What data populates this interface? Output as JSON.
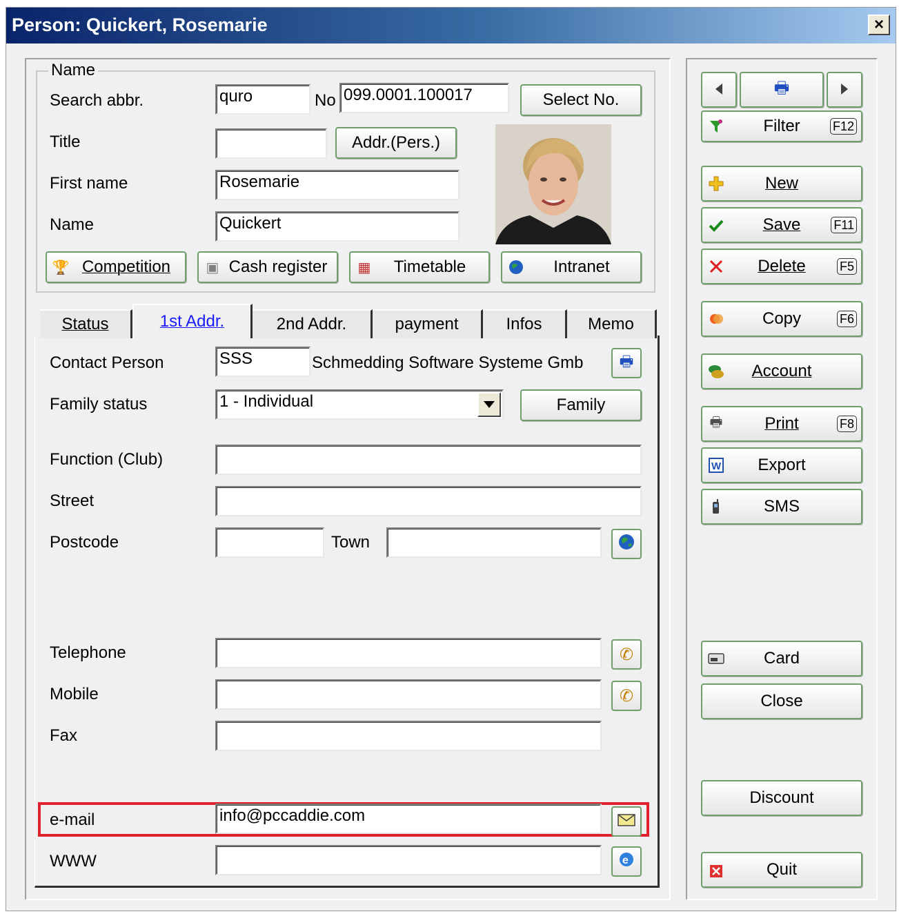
{
  "window": {
    "title": "Person: Quickert, Rosemarie",
    "close_label": "×"
  },
  "name_group": {
    "legend": "Name",
    "search_abbr_label": "Search abbr.",
    "search_abbr_value": "quro",
    "no_label": "No",
    "no_value": "099.0001.100017",
    "select_no_label": "Select No.",
    "title_label": "Title",
    "title_value": "",
    "addr_pers_label": "Addr.(Pers.)",
    "first_name_label": "First name",
    "first_name_value": "Rosemarie",
    "name_label": "Name",
    "name_value": "Quickert",
    "competition_label": "Competition",
    "cash_register_label": "Cash register",
    "timetable_label": "Timetable",
    "intranet_label": "Intranet"
  },
  "tabs": [
    "Status",
    "1st Addr.",
    "2nd Addr.",
    "payment",
    "Infos",
    "Memo"
  ],
  "active_tab": "1st Addr.",
  "address": {
    "contact_person_label": "Contact Person",
    "contact_person_code": "SSS",
    "contact_person_name": "Schmedding Software Systeme Gmb",
    "family_status_label": "Family status",
    "family_status_value": "1 - Individual",
    "family_button_label": "Family",
    "function_label": "Function (Club)",
    "function_value": "",
    "street_label": "Street",
    "street_value": "",
    "postcode_label": "Postcode",
    "postcode_value": "",
    "town_label": "Town",
    "town_value": "",
    "telephone_label": "Telephone",
    "telephone_value": "",
    "mobile_label": "Mobile",
    "mobile_value": "",
    "fax_label": "Fax",
    "fax_value": "",
    "email_label": "e-mail",
    "email_value": "info@pccaddie.com",
    "www_label": "WWW",
    "www_value": ""
  },
  "sidebar": {
    "filter_label": "Filter",
    "filter_key": "F12",
    "new_label": "New",
    "save_label": "Save",
    "save_key": "F11",
    "delete_label": "Delete",
    "delete_key": "F5",
    "copy_label": "Copy",
    "copy_key": "F6",
    "account_label": "Account",
    "print_label": "Print",
    "print_key": "F8",
    "export_label": "Export",
    "sms_label": "SMS",
    "card_label": "Card",
    "close_label": "Close",
    "discount_label": "Discount",
    "quit_label": "Quit"
  },
  "colors": {
    "highlight": "#e0202a",
    "title_start": "#0a246a",
    "title_end": "#a6caf0",
    "button_border": "#6e9e6e"
  }
}
